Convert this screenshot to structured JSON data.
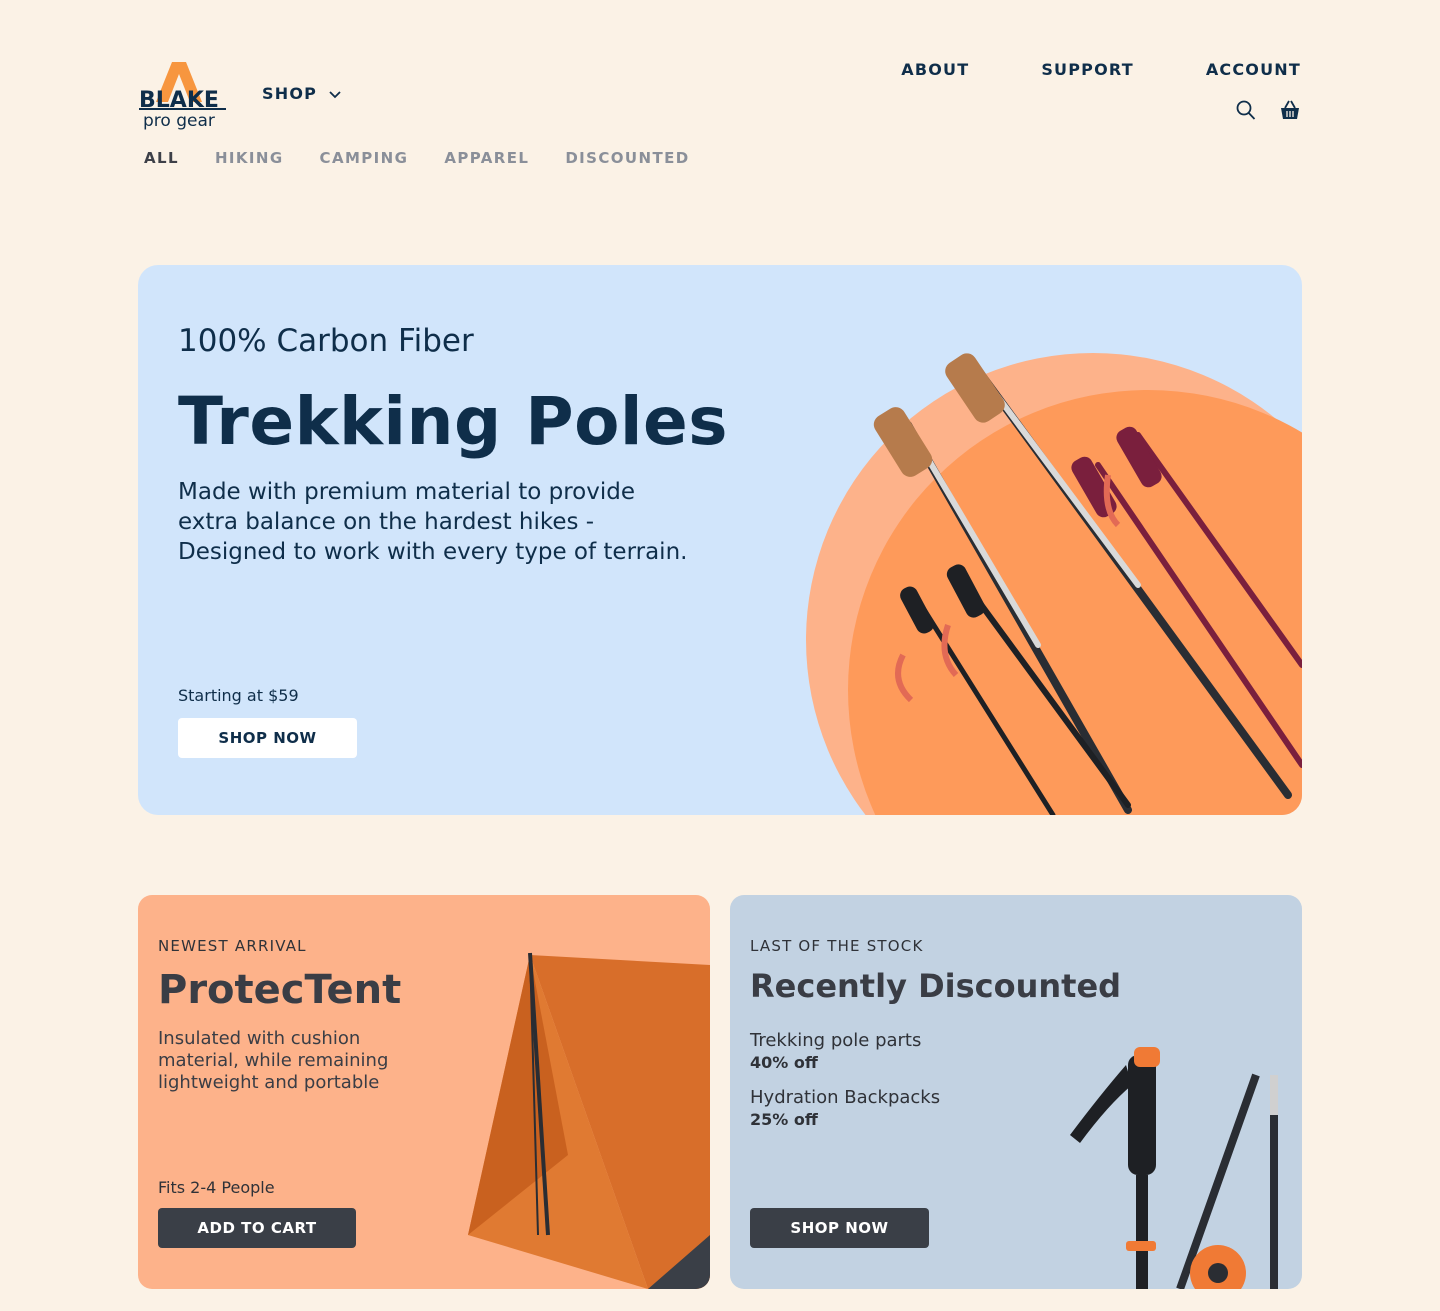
{
  "brand": {
    "wordmark": "BLAKE",
    "tagline": "pro gear"
  },
  "header": {
    "shop_label": "SHOP",
    "top_nav": [
      "ABOUT",
      "SUPPORT",
      "ACCOUNT"
    ],
    "categories": [
      "ALL",
      "HIKING",
      "CAMPING",
      "APPAREL",
      "DISCOUNTED"
    ],
    "active_category": "ALL"
  },
  "hero": {
    "eyebrow": "100% Carbon Fiber",
    "title": "Trekking Poles",
    "description": "Made with premium material to provide extra balance on the hardest hikes - Designed to work with every type of terrain.",
    "price_note": "Starting at $59",
    "cta": "SHOP NOW"
  },
  "card_new": {
    "kicker": "NEWEST ARRIVAL",
    "title": "ProtecTent",
    "description": "Insulated with cushion material, while remaining lightweight and portable",
    "note": "Fits 2-4 People",
    "cta": "ADD TO CART"
  },
  "card_discount": {
    "kicker": "LAST OF THE STOCK",
    "title": "Recently Discounted",
    "deals": [
      {
        "name": "Trekking pole parts",
        "discount": "40% off"
      },
      {
        "name": "Hydration Backpacks",
        "discount": "25% off"
      }
    ],
    "cta": "SHOP NOW"
  },
  "colors": {
    "page_bg": "#FBF2E6",
    "navy": "#0F2E4A",
    "orange": "#F79A55",
    "hero_bg": "#D1E5FB",
    "peach": "#FDB28A",
    "slate": "#C2D2E2",
    "button_dark": "#3A3F47"
  }
}
